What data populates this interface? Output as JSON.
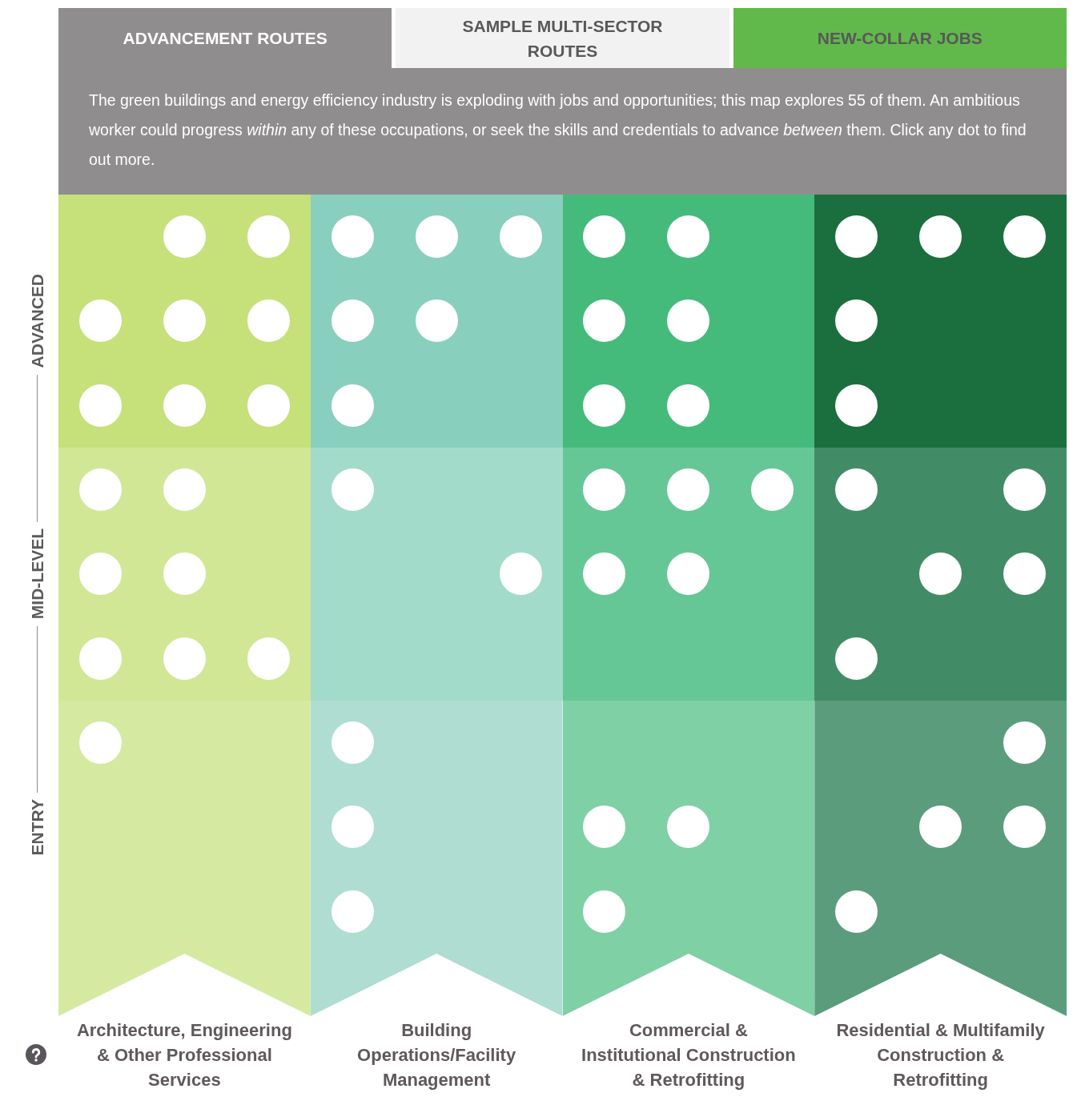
{
  "tabs": [
    {
      "label": "ADVANCEMENT ROUTES",
      "selected": true,
      "color": "#8f8d8e"
    },
    {
      "label": "SAMPLE MULTI-SECTOR ROUTES",
      "selected": false,
      "color": "#f2f2f2"
    },
    {
      "label": "NEW-COLLAR JOBS",
      "selected": false,
      "color": "#62b94b"
    }
  ],
  "description": "The green buildings and energy efficiency industry is exploding with jobs and opportunities; this map explores 55 of them. An ambitious worker could progress *within* any of these occupations, or seek the skills and credentials to advance *between* them. Click any dot to find out more.",
  "level_axis": [
    "ADVANCED",
    "MID-LEVEL",
    "ENTRY"
  ],
  "sectors": [
    {
      "label": "Architecture, Engineering & Other Professional Services",
      "levels": [
        {
          "color": "#c6e07a",
          "dots": [
            [
              false,
              true,
              true
            ],
            [
              true,
              true,
              true
            ],
            [
              true,
              true,
              true
            ]
          ]
        },
        {
          "color": "#d1e795",
          "dots": [
            [
              true,
              true,
              false
            ],
            [
              true,
              true,
              false
            ],
            [
              true,
              true,
              true
            ]
          ]
        },
        {
          "color": "#d5e9a1",
          "dots": [
            [
              true,
              false,
              false
            ],
            [
              false,
              false,
              false
            ],
            [
              false,
              false,
              false
            ]
          ]
        }
      ]
    },
    {
      "label": "Building Operations/Facility Management",
      "levels": [
        {
          "color": "#89cfbd",
          "dots": [
            [
              true,
              true,
              true
            ],
            [
              true,
              true,
              false
            ],
            [
              true,
              false,
              false
            ]
          ]
        },
        {
          "color": "#a3dbcb",
          "dots": [
            [
              true,
              false,
              false
            ],
            [
              false,
              false,
              true
            ],
            [
              false,
              false,
              false
            ]
          ]
        },
        {
          "color": "#afddd2",
          "dots": [
            [
              true,
              false,
              false
            ],
            [
              true,
              false,
              false
            ],
            [
              true,
              false,
              false
            ]
          ]
        }
      ]
    },
    {
      "label": "Commercial & Institutional Construction & Retrofitting",
      "levels": [
        {
          "color": "#44bb7b",
          "dots": [
            [
              true,
              true,
              false
            ],
            [
              true,
              true,
              false
            ],
            [
              true,
              true,
              false
            ]
          ]
        },
        {
          "color": "#66c796",
          "dots": [
            [
              true,
              true,
              true
            ],
            [
              true,
              true,
              false
            ],
            [
              false,
              false,
              false
            ]
          ]
        },
        {
          "color": "#7fd0a5",
          "dots": [
            [
              false,
              false,
              false
            ],
            [
              true,
              true,
              false
            ],
            [
              true,
              false,
              false
            ]
          ]
        }
      ]
    },
    {
      "label": "Residential & Multifamily Construction & Retrofitting",
      "levels": [
        {
          "color": "#1b6e3d",
          "dots": [
            [
              true,
              true,
              true
            ],
            [
              true,
              false,
              false
            ],
            [
              true,
              false,
              false
            ]
          ]
        },
        {
          "color": "#418c67",
          "dots": [
            [
              true,
              false,
              true
            ],
            [
              false,
              true,
              true
            ],
            [
              true,
              false,
              false
            ]
          ]
        },
        {
          "color": "#5b9c7d",
          "dots": [
            [
              false,
              false,
              true
            ],
            [
              false,
              true,
              true
            ],
            [
              true,
              false,
              false
            ]
          ]
        }
      ]
    }
  ]
}
